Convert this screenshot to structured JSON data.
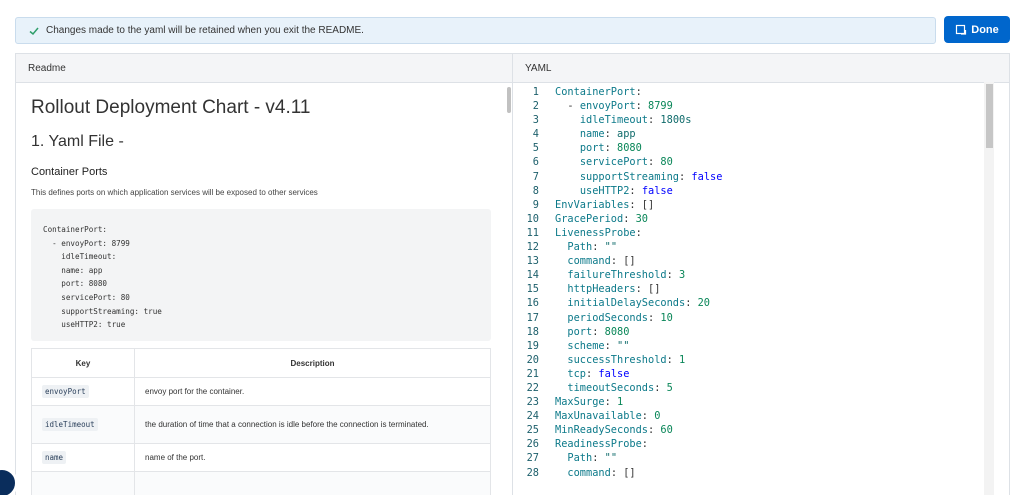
{
  "notice": {
    "text": "Changes made to the yaml will be retained when you exit the README."
  },
  "done_button": {
    "label": "Done"
  },
  "panels": {
    "readme_label": "Readme",
    "yaml_label": "YAML"
  },
  "readme": {
    "title": "Rollout Deployment Chart - v4.11",
    "section": "1. Yaml File -",
    "subsection": "Container Ports",
    "description": "This defines ports on which application services will be exposed to other services",
    "code": "ContainerPort:\n  - envoyPort: 8799\n    idleTimeout:\n    name: app\n    port: 8080\n    servicePort: 80\n    supportStreaming: true\n    useHTTP2: true",
    "table": {
      "headers": [
        "Key",
        "Description"
      ],
      "rows": [
        {
          "key": "envoyPort",
          "desc": "envoy port for the container."
        },
        {
          "key": "idleTimeout",
          "desc": "the duration of time that a connection is idle before the connection is terminated."
        },
        {
          "key": "name",
          "desc": "name of the port."
        }
      ]
    }
  },
  "yaml": {
    "lines": [
      [
        "1",
        [
          [
            "k",
            "ContainerPort"
          ],
          [
            "p",
            ":"
          ]
        ]
      ],
      [
        "2",
        [
          [
            "p",
            "  - "
          ],
          [
            "k",
            "envoyPort"
          ],
          [
            "p",
            ": "
          ],
          [
            "n",
            "8799"
          ]
        ]
      ],
      [
        "3",
        [
          [
            "p",
            "    "
          ],
          [
            "k",
            "idleTimeout"
          ],
          [
            "p",
            ": "
          ],
          [
            "s",
            "1800s"
          ]
        ]
      ],
      [
        "4",
        [
          [
            "p",
            "    "
          ],
          [
            "k",
            "name"
          ],
          [
            "p",
            ": "
          ],
          [
            "s",
            "app"
          ]
        ]
      ],
      [
        "5",
        [
          [
            "p",
            "    "
          ],
          [
            "k",
            "port"
          ],
          [
            "p",
            ": "
          ],
          [
            "n",
            "8080"
          ]
        ]
      ],
      [
        "6",
        [
          [
            "p",
            "    "
          ],
          [
            "k",
            "servicePort"
          ],
          [
            "p",
            ": "
          ],
          [
            "n",
            "80"
          ]
        ]
      ],
      [
        "7",
        [
          [
            "p",
            "    "
          ],
          [
            "k",
            "supportStreaming"
          ],
          [
            "p",
            ": "
          ],
          [
            "b",
            "false"
          ]
        ]
      ],
      [
        "8",
        [
          [
            "p",
            "    "
          ],
          [
            "k",
            "useHTTP2"
          ],
          [
            "p",
            ": "
          ],
          [
            "b",
            "false"
          ]
        ]
      ],
      [
        "9",
        [
          [
            "k",
            "EnvVariables"
          ],
          [
            "p",
            ": []"
          ]
        ]
      ],
      [
        "10",
        [
          [
            "k",
            "GracePeriod"
          ],
          [
            "p",
            ": "
          ],
          [
            "n",
            "30"
          ]
        ]
      ],
      [
        "11",
        [
          [
            "k",
            "LivenessProbe"
          ],
          [
            "p",
            ":"
          ]
        ]
      ],
      [
        "12",
        [
          [
            "p",
            "  "
          ],
          [
            "k",
            "Path"
          ],
          [
            "p",
            ": "
          ],
          [
            "s",
            "\"\""
          ]
        ]
      ],
      [
        "13",
        [
          [
            "p",
            "  "
          ],
          [
            "k",
            "command"
          ],
          [
            "p",
            ": []"
          ]
        ]
      ],
      [
        "14",
        [
          [
            "p",
            "  "
          ],
          [
            "k",
            "failureThreshold"
          ],
          [
            "p",
            ": "
          ],
          [
            "n",
            "3"
          ]
        ]
      ],
      [
        "15",
        [
          [
            "p",
            "  "
          ],
          [
            "k",
            "httpHeaders"
          ],
          [
            "p",
            ": []"
          ]
        ]
      ],
      [
        "16",
        [
          [
            "p",
            "  "
          ],
          [
            "k",
            "initialDelaySeconds"
          ],
          [
            "p",
            ": "
          ],
          [
            "n",
            "20"
          ]
        ]
      ],
      [
        "17",
        [
          [
            "p",
            "  "
          ],
          [
            "k",
            "periodSeconds"
          ],
          [
            "p",
            ": "
          ],
          [
            "n",
            "10"
          ]
        ]
      ],
      [
        "18",
        [
          [
            "p",
            "  "
          ],
          [
            "k",
            "port"
          ],
          [
            "p",
            ": "
          ],
          [
            "n",
            "8080"
          ]
        ]
      ],
      [
        "19",
        [
          [
            "p",
            "  "
          ],
          [
            "k",
            "scheme"
          ],
          [
            "p",
            ": "
          ],
          [
            "s",
            "\"\""
          ]
        ]
      ],
      [
        "20",
        [
          [
            "p",
            "  "
          ],
          [
            "k",
            "successThreshold"
          ],
          [
            "p",
            ": "
          ],
          [
            "n",
            "1"
          ]
        ]
      ],
      [
        "21",
        [
          [
            "p",
            "  "
          ],
          [
            "k",
            "tcp"
          ],
          [
            "p",
            ": "
          ],
          [
            "b",
            "false"
          ]
        ]
      ],
      [
        "22",
        [
          [
            "p",
            "  "
          ],
          [
            "k",
            "timeoutSeconds"
          ],
          [
            "p",
            ": "
          ],
          [
            "n",
            "5"
          ]
        ]
      ],
      [
        "23",
        [
          [
            "k",
            "MaxSurge"
          ],
          [
            "p",
            ": "
          ],
          [
            "n",
            "1"
          ]
        ]
      ],
      [
        "24",
        [
          [
            "k",
            "MaxUnavailable"
          ],
          [
            "p",
            ": "
          ],
          [
            "n",
            "0"
          ]
        ]
      ],
      [
        "25",
        [
          [
            "k",
            "MinReadySeconds"
          ],
          [
            "p",
            ": "
          ],
          [
            "n",
            "60"
          ]
        ]
      ],
      [
        "26",
        [
          [
            "k",
            "ReadinessProbe"
          ],
          [
            "p",
            ":"
          ]
        ]
      ],
      [
        "27",
        [
          [
            "p",
            "  "
          ],
          [
            "k",
            "Path"
          ],
          [
            "p",
            ": "
          ],
          [
            "s",
            "\"\""
          ]
        ]
      ],
      [
        "28",
        [
          [
            "p",
            "  "
          ],
          [
            "k",
            "command"
          ],
          [
            "p",
            ": []"
          ]
        ]
      ]
    ]
  },
  "colors": {
    "accent": "#0066cc",
    "notice_bg": "#e8f2fa"
  }
}
